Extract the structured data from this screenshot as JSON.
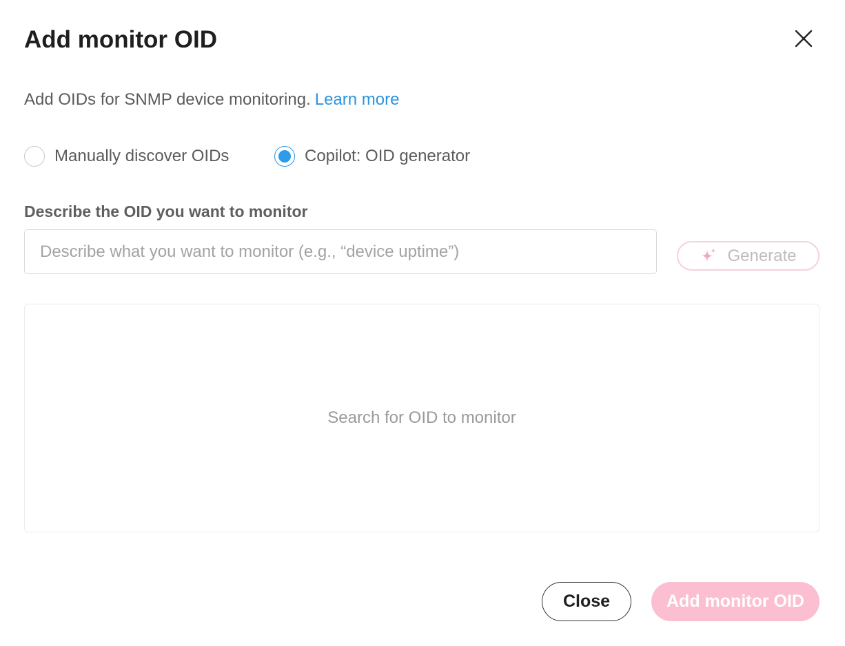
{
  "dialog": {
    "title": "Add monitor OID",
    "description": "Add OIDs for SNMP device monitoring.",
    "learn_more": "Learn more"
  },
  "mode": {
    "options": [
      {
        "label": "Manually discover OIDs",
        "selected": false
      },
      {
        "label": "Copilot: OID generator",
        "selected": true
      }
    ]
  },
  "oid_field": {
    "label": "Describe the OID you want to monitor",
    "value": "",
    "placeholder": "Describe what you want to monitor (e.g., “device uptime”)"
  },
  "generate_button": {
    "label": "Generate",
    "icon": "sparkle-icon"
  },
  "results": {
    "empty_text": "Search for OID to monitor"
  },
  "footer": {
    "close_label": "Close",
    "add_label": "Add monitor OID"
  },
  "colors": {
    "accent": "#2f9bea",
    "primary_disabled": "#fbbfd1",
    "generate_icon": "#f4a6bd"
  }
}
